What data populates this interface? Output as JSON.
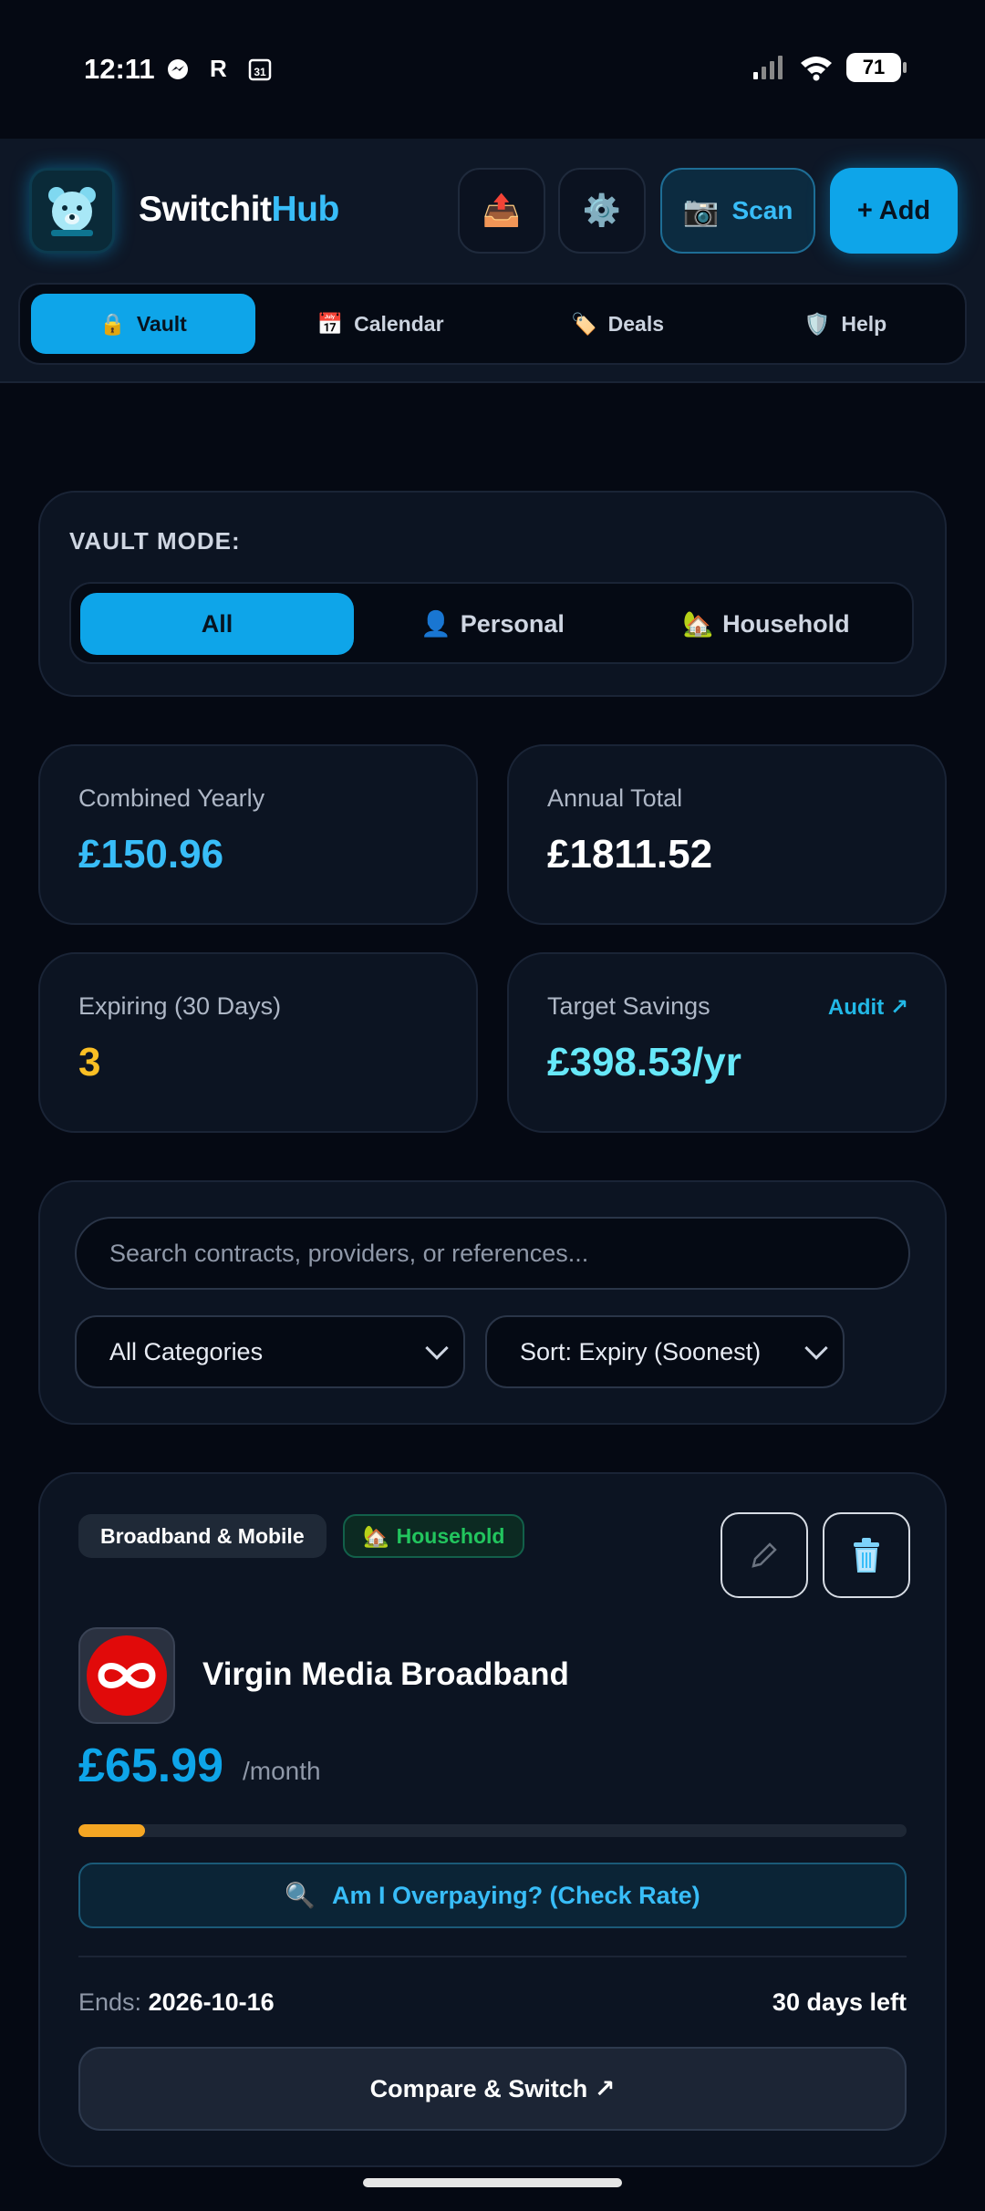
{
  "status_bar": {
    "time": "12:11",
    "battery": "71"
  },
  "app": {
    "title_part1": "Switchit",
    "title_part2": "Hub"
  },
  "header": {
    "scan_label": "Scan",
    "add_label": "+ Add"
  },
  "tabs": [
    {
      "label": "Vault",
      "icon": "lock-icon",
      "glyph": "🔒"
    },
    {
      "label": "Calendar",
      "icon": "calendar-icon",
      "glyph": "📅"
    },
    {
      "label": "Deals",
      "icon": "tag-icon",
      "glyph": "🏷️"
    },
    {
      "label": "Help",
      "icon": "shield-icon",
      "glyph": "🛡️"
    }
  ],
  "vault_mode": {
    "label": "VAULT MODE:",
    "options": [
      {
        "label": "All"
      },
      {
        "label": "Personal",
        "glyph": "👤"
      },
      {
        "label": "Household",
        "glyph": "🏡"
      }
    ]
  },
  "stats": {
    "combined_yearly": {
      "label": "Combined Yearly",
      "value": "£150.96"
    },
    "annual_total": {
      "label": "Annual Total",
      "value": "£1811.52"
    },
    "expiring": {
      "label": "Expiring (30 Days)",
      "value": "3"
    },
    "target_savings": {
      "label": "Target Savings",
      "value": "£398.53/yr",
      "link": "Audit ↗"
    }
  },
  "filters": {
    "search_placeholder": "Search contracts, providers, or references...",
    "category": "All Categories",
    "sort": "Sort: Expiry (Soonest)"
  },
  "contract": {
    "category": "Broadband & Mobile",
    "scope": "Household",
    "scope_glyph": "🏡",
    "provider": "Virgin Media Broadband",
    "price": "£65.99",
    "period": "/month",
    "term_elapsed_fraction": 0.08,
    "check_rate_label": "Am I Overpaying? (Check Rate)",
    "ends_label": "Ends:",
    "ends_date": "2026-10-16",
    "days_left": "30 days left",
    "compare_label": "Compare & Switch ↗"
  },
  "colors": {
    "accent": "#0ea5e9",
    "expiring": "#fbbf24",
    "savings": "#67e8f9",
    "household": "#22c55e",
    "progress": "#f5a623",
    "brand_virgin": "#e10a0a"
  }
}
